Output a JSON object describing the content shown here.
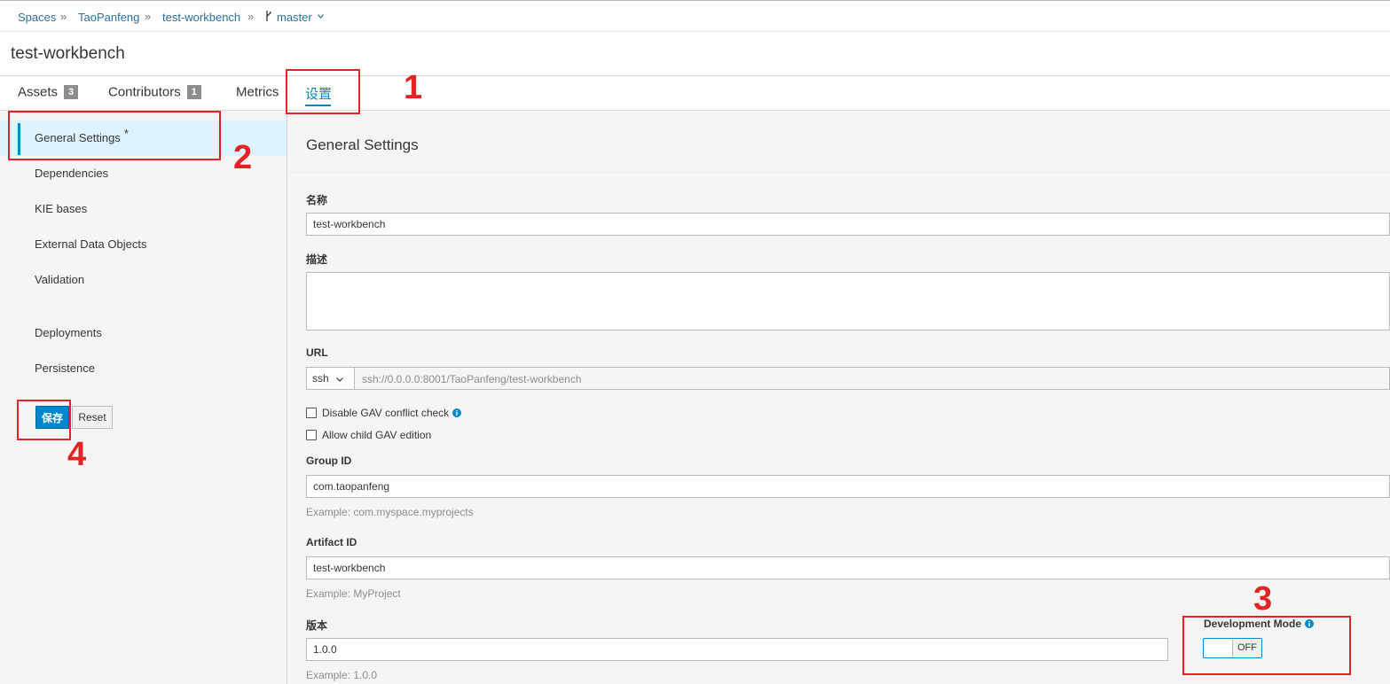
{
  "breadcrumb": {
    "spaces": "Spaces",
    "space": "TaoPanfeng",
    "project": "test-workbench",
    "branch": "master",
    "separator": "»"
  },
  "page_title": "test-workbench",
  "tabs": {
    "assets": {
      "label": "Assets",
      "count": "3"
    },
    "contributors": {
      "label": "Contributors",
      "count": "1"
    },
    "metrics": {
      "label": "Metrics"
    },
    "settings": {
      "label": "设置"
    }
  },
  "sidebar": {
    "items": [
      {
        "label": "General Settings",
        "marker": "*"
      },
      {
        "label": "Dependencies"
      },
      {
        "label": "KIE bases"
      },
      {
        "label": "External Data Objects"
      },
      {
        "label": "Validation"
      },
      {
        "label": "Deployments"
      },
      {
        "label": "Persistence"
      }
    ],
    "save_label": "保存",
    "reset_label": "Reset"
  },
  "main": {
    "section_title": "General Settings",
    "name_label": "名称",
    "name_value": "test-workbench",
    "description_label": "描述",
    "description_value": "",
    "url_label": "URL",
    "url_protocol": "ssh",
    "url_value": "ssh://0.0.0.0:8001/TaoPanfeng/test-workbench",
    "disable_gav_label": "Disable GAV conflict check",
    "allow_child_gav_label": "Allow child GAV edition",
    "group_id_label": "Group ID",
    "group_id_value": "com.taopanfeng",
    "group_id_help": "Example: com.myspace.myprojects",
    "artifact_id_label": "Artifact ID",
    "artifact_id_value": "test-workbench",
    "artifact_id_help": "Example: MyProject",
    "version_label": "版本",
    "version_value": "1.0.0",
    "version_help": "Example: 1.0.0",
    "dev_mode_label": "Development Mode",
    "dev_mode_state": "OFF"
  },
  "annotations": [
    "1",
    "2",
    "3",
    "4"
  ],
  "colors": {
    "accent": "#0088ce",
    "annotation_red": "#e32424",
    "link": "#2b6f9e",
    "badge": "#8b8d8f"
  }
}
